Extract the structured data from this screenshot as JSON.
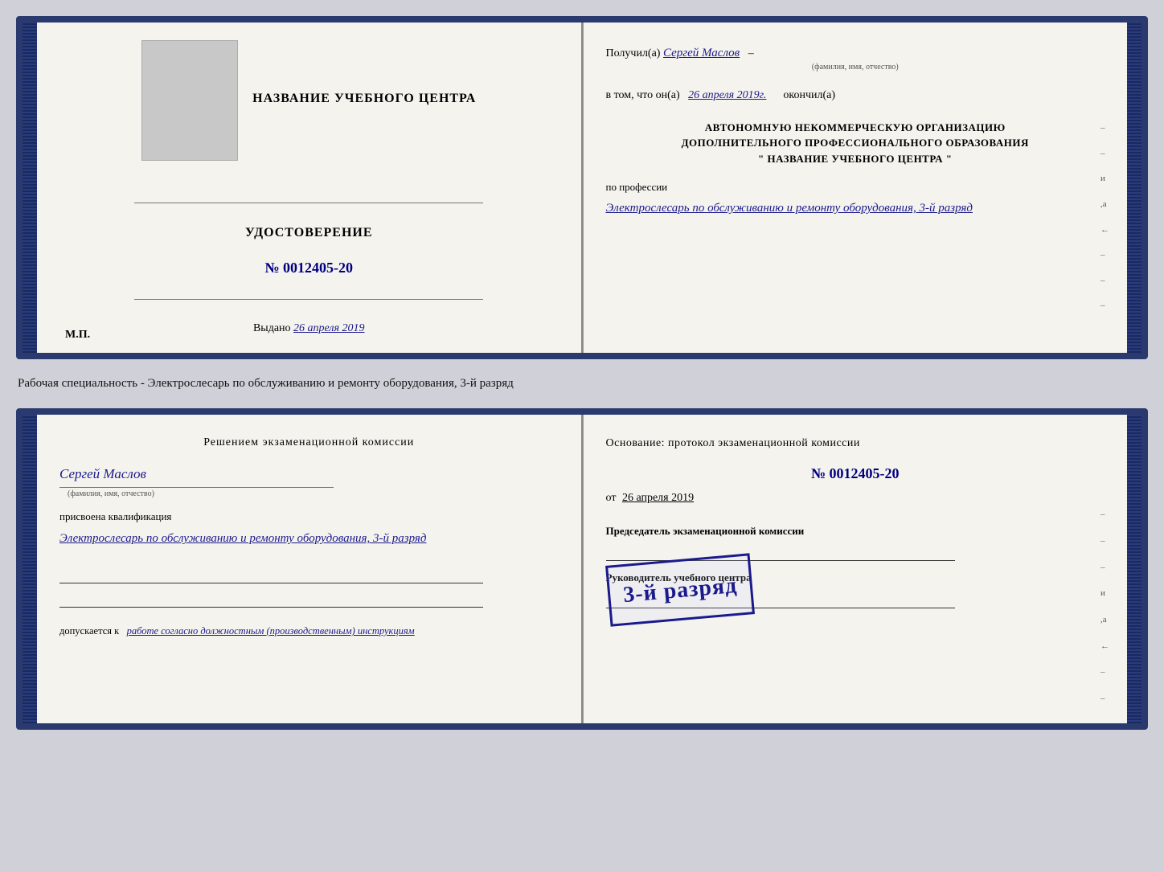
{
  "doc1": {
    "left": {
      "training_center_label": "НАЗВАНИЕ УЧЕБНОГО ЦЕНТРА",
      "cert_title": "УДОСТОВЕРЕНИЕ",
      "cert_number": "№ 0012405-20",
      "issued_label": "Выдано",
      "issued_date": "26 апреля 2019",
      "mp_label": "М.П."
    },
    "right": {
      "received_label": "Получил(а)",
      "received_name": "Сергей Маслов",
      "fio_hint": "(фамилия, имя, отчество)",
      "date_label": "в том, что он(а)",
      "date_value": "26 апреля 2019г.",
      "finished_label": "окончил(а)",
      "org_line1": "АВТОНОМНУЮ НЕКОММЕРЧЕСКУЮ ОРГАНИЗАЦИЮ",
      "org_line2": "ДОПОЛНИТЕЛЬНОГО ПРОФЕССИОНАЛЬНОГО ОБРАЗОВАНИЯ",
      "org_line3": "\" НАЗВАНИЕ УЧЕБНОГО ЦЕНТРА \"",
      "profession_label": "по профессии",
      "profession_value": "Электрослесарь по обслуживанию и ремонту оборудования, 3-й разряд"
    }
  },
  "between": {
    "text": "Рабочая специальность - Электрослесарь по обслуживанию и ремонту оборудования, 3-й разряд"
  },
  "doc2": {
    "left": {
      "commission_title": "Решением экзаменационной комиссии",
      "person_name": "Сергей Маслов",
      "fio_hint": "(фамилия, имя, отчество)",
      "assigned_label": "присвоена квалификация",
      "qualification_value": "Электрослесарь по обслуживанию и ремонту оборудования, 3-й разряд",
      "allowed_label": "допускается к",
      "allowed_value": "работе согласно должностным (производственным) инструкциям"
    },
    "right": {
      "basis_label": "Основание: протокол экзаменационной комиссии",
      "protocol_number": "№ 0012405-20",
      "date_prefix": "от",
      "date_value": "26 апреля 2019",
      "chairman_label": "Председатель экзаменационной комиссии",
      "director_label": "Руководитель учебного центра"
    },
    "stamp": {
      "small_text": "",
      "main_text": "3-й разряд"
    }
  }
}
